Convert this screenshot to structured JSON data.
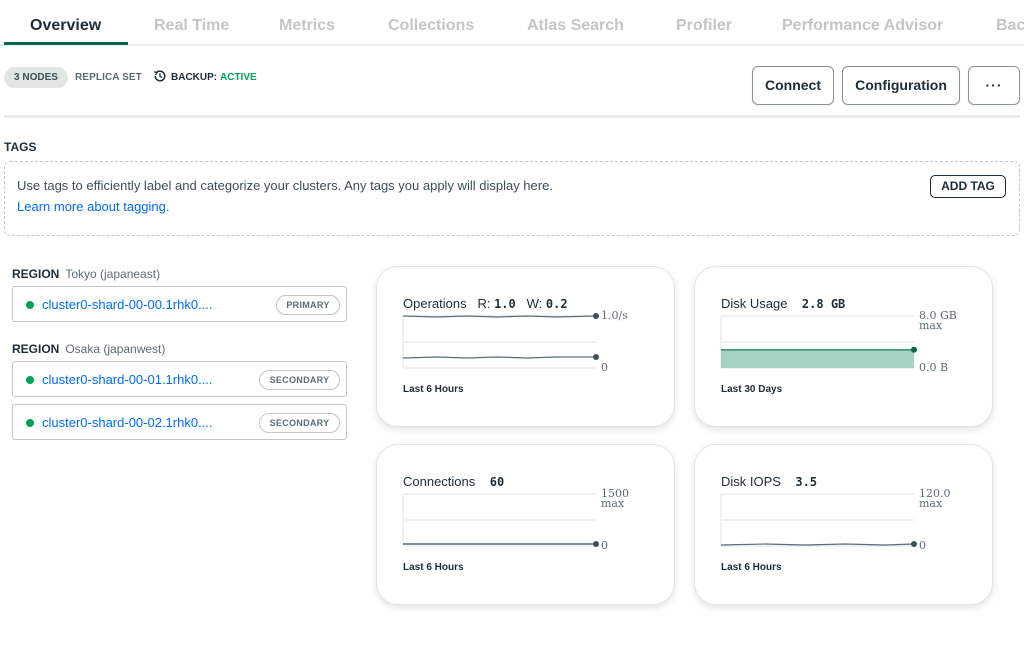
{
  "tabs": [
    "Overview",
    "Real Time",
    "Metrics",
    "Collections",
    "Atlas Search",
    "Profiler",
    "Performance Advisor",
    "Bac"
  ],
  "status": {
    "nodes": "3 NODES",
    "type": "REPLICA SET",
    "backup_label": "BACKUP:",
    "backup_value": "ACTIVE",
    "backup_color": "#00a35c"
  },
  "actions": {
    "connect": "Connect",
    "configuration": "Configuration",
    "more": "···"
  },
  "tags": {
    "title": "TAGS",
    "description": "Use tags to efficiently label and categorize your clusters. Any tags you apply will display here.",
    "link": "Learn more about tagging.",
    "add_button": "ADD TAG"
  },
  "regions": [
    {
      "label": "REGION",
      "name": "Tokyo (japaneast)",
      "nodes": [
        {
          "host": "cluster0-shard-00-00.1rhk0....",
          "role": "PRIMARY"
        }
      ]
    },
    {
      "label": "REGION",
      "name": "Osaka (japanwest)",
      "nodes": [
        {
          "host": "cluster0-shard-00-01.1rhk0....",
          "role": "SECONDARY"
        },
        {
          "host": "cluster0-shard-00-02.1rhk0....",
          "role": "SECONDARY"
        }
      ]
    }
  ],
  "metrics": {
    "operations": {
      "title": "Operations",
      "r_label": "R:",
      "r_value": "1.0",
      "w_label": "W:",
      "w_value": "0.2",
      "max_label": "1.0/s",
      "min_label": "0",
      "period": "Last 6 Hours"
    },
    "disk_usage": {
      "title": "Disk Usage",
      "value": "2.8 GB",
      "max_label": "8.0 GB",
      "max_sub": "max",
      "min_label": "0.0 B",
      "period": "Last 30 Days",
      "fill_fraction": 0.35
    },
    "connections": {
      "title": "Connections",
      "value": "60",
      "max_label": "1500",
      "max_sub": "max",
      "min_label": "0",
      "period": "Last 6 Hours"
    },
    "disk_iops": {
      "title": "Disk IOPS",
      "value": "3.5",
      "max_label": "120.0",
      "max_sub": "max",
      "min_label": "0",
      "period": "Last 6 Hours"
    }
  },
  "colors": {
    "accent": "#00684a",
    "link": "#016bf8",
    "status_green": "#00a35c",
    "area_fill": "#a6d3c1"
  }
}
